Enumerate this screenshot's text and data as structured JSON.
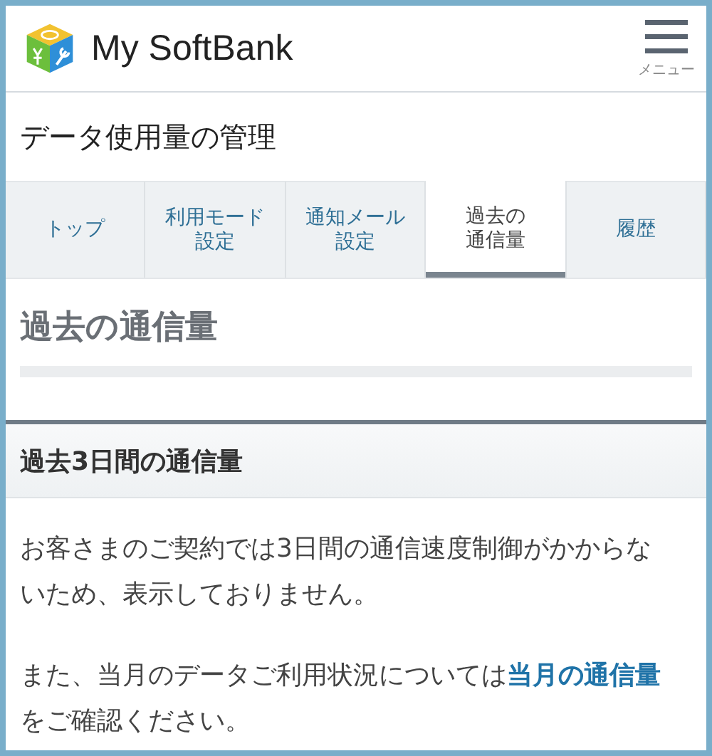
{
  "header": {
    "brand": "My SoftBank",
    "menu_label": "メニュー"
  },
  "page_title": "データ使用量の管理",
  "tabs": [
    {
      "lines": [
        "トップ"
      ],
      "selected": false
    },
    {
      "lines": [
        "利用モード",
        "設定"
      ],
      "selected": false
    },
    {
      "lines": [
        "通知メール",
        "設定"
      ],
      "selected": false
    },
    {
      "lines": [
        "過去の",
        "通信量"
      ],
      "selected": true
    },
    {
      "lines": [
        "履歴"
      ],
      "selected": false
    }
  ],
  "section_title": "過去の通信量",
  "subsection": {
    "title": "過去3日間の通信量",
    "paragraph_1": "お客さまのご契約では3日間の通信速度制御がかからないため、表示しておりません。",
    "paragraph_2": {
      "before": "また、当月のデータご利用状況については",
      "link": "当月の通信量",
      "after": "をご確認ください。"
    }
  }
}
